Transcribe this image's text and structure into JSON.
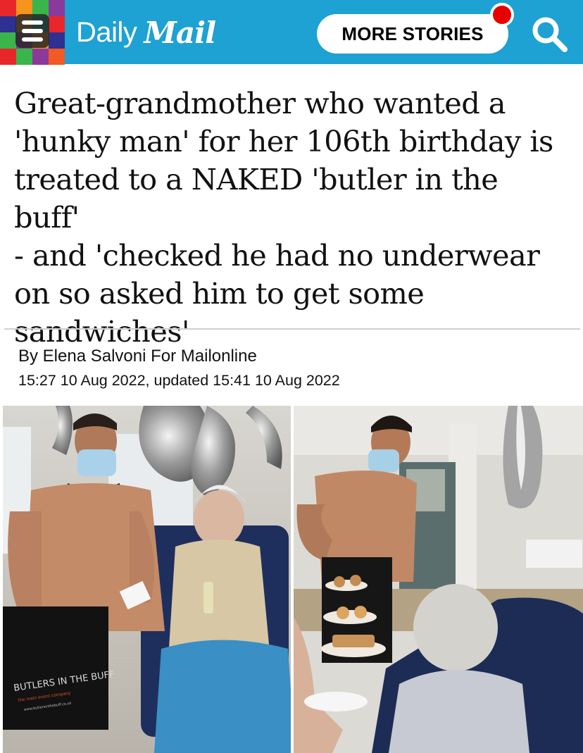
{
  "header": {
    "logo_daily": "Daily",
    "logo_mail": "Mail",
    "more_stories_label": "MORE STORIES",
    "menu_colors": [
      "#e9272b",
      "#f7941d",
      "#39b54a",
      "#8b3a9b",
      "#2e3192",
      "#f7941d",
      "#00a99d",
      "#e9272b",
      "#39b54a",
      "#8b3a9b",
      "#f7941d",
      "#2e3192",
      "#e9272b",
      "#39b54a",
      "#8b3a9b",
      "#f15a24"
    ]
  },
  "article": {
    "headline_lines": [
      "Great-grandmother who wanted a",
      "'hunky man' for her 106th birthday is",
      "treated to a NAKED 'butler in the buff'",
      "- and 'checked he had no underwear",
      "on so asked him to get some",
      "sandwiches'"
    ],
    "byline": "By Elena Salvoni For Mailonline",
    "dateline": "15:27 10 Aug 2022, updated 15:41 10 Aug 2022"
  },
  "photos": {
    "left_apron_text": "BUTLERS IN THE BUFF",
    "left_apron_small": "the main event company",
    "left_apron_url": "www.butlersinthebuff.co.uk"
  }
}
